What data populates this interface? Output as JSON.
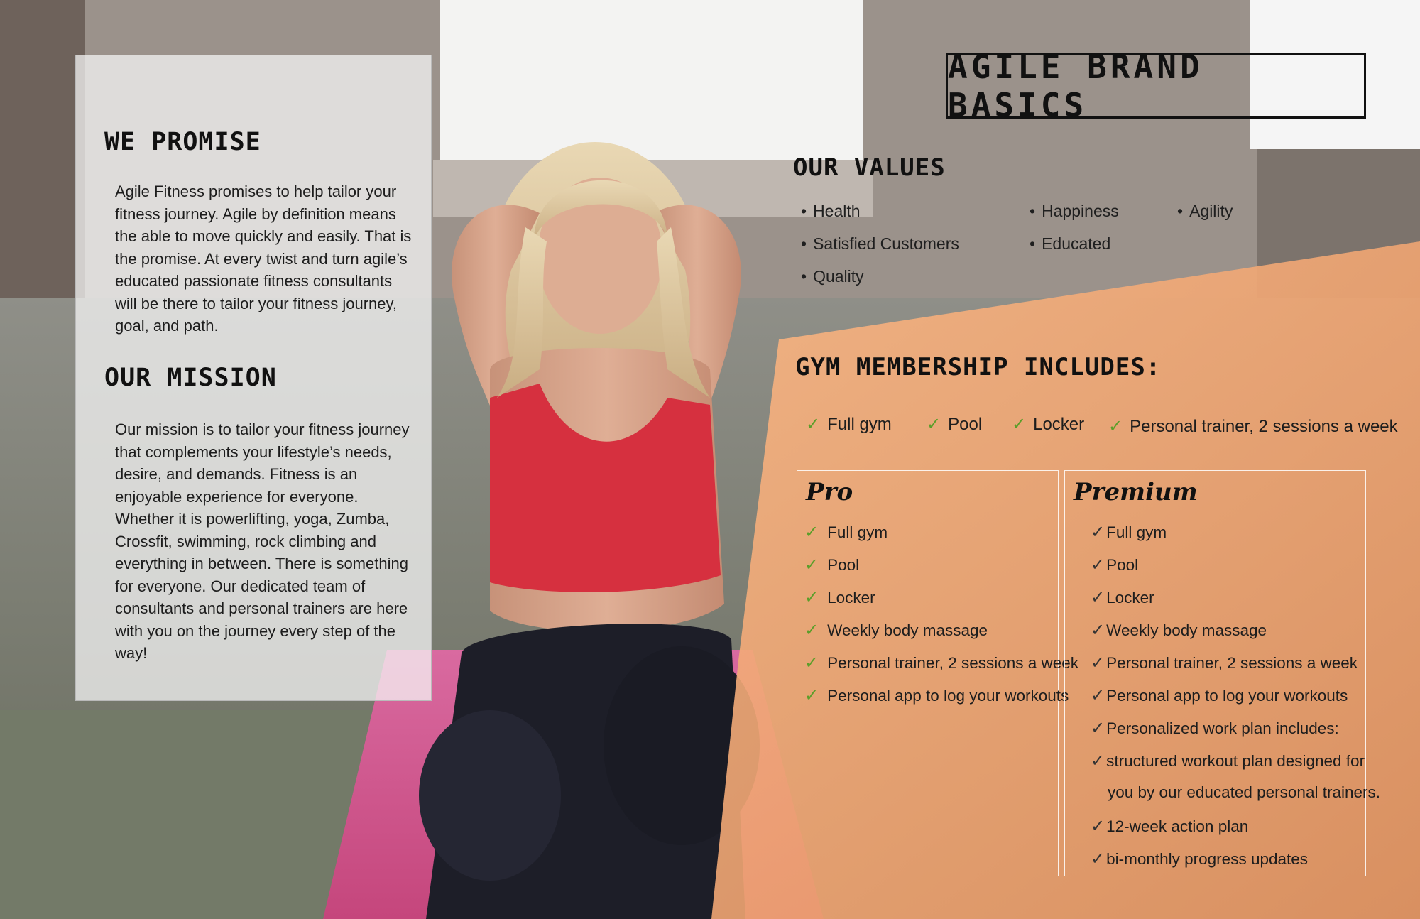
{
  "page_title": "Agile Brand Basics",
  "promise": {
    "heading": "We Promise",
    "text": "Agile Fitness promises to help tailor your fitness journey. Agile by definition means the able to move quickly and easily. That is the promise. At every twist and turn agile’s educated passionate fitness consultants will be there to tailor your fitness journey, goal, and path."
  },
  "mission": {
    "heading": "Our Mission",
    "text": "Our mission is to tailor your fitness journey that complements your lifestyle’s needs, desire, and demands. Fitness is an enjoyable experience for everyone. Whether it is powerlifting, yoga, Zumba, Crossfit, swimming, rock climbing and everything in between. There is something for everyone. Our dedicated team of consultants and personal trainers are here with you on the journey every step of the way!"
  },
  "values": {
    "heading": "Our Values",
    "items": [
      "Health",
      "Happiness",
      "Agility",
      "Satisfied Customers",
      "Educated",
      "Quality"
    ]
  },
  "membership": {
    "heading": "Gym Membership Includes:",
    "items": [
      "Full gym",
      "Pool",
      "Locker",
      "Personal trainer, 2 sessions a week"
    ]
  },
  "plans": {
    "pro": {
      "title": "Pro",
      "features": [
        "Full gym",
        "Pool",
        "Locker",
        "Weekly body massage",
        "Personal trainer, 2 sessions a week",
        "Personal app to log your workouts"
      ]
    },
    "premium": {
      "title": "Premium",
      "features": [
        "Full gym",
        "Pool",
        "Locker",
        "Weekly body massage",
        "Personal trainer, 2 sessions a week",
        "Personal app to log your workouts",
        "Personalized work plan includes:",
        "structured workout plan designed for",
        "you by our educated personal trainers.",
        "12-week action plan",
        "bi-monthly progress updates"
      ]
    }
  },
  "icons": {
    "check": "checkmark-icon",
    "bullet": "bullet-icon"
  },
  "colors": {
    "accent_orange": "#f6ad77",
    "check_green": "#5c9e2a",
    "shirt_red": "#d6303f",
    "mat_pink": "#cf5a8a"
  }
}
